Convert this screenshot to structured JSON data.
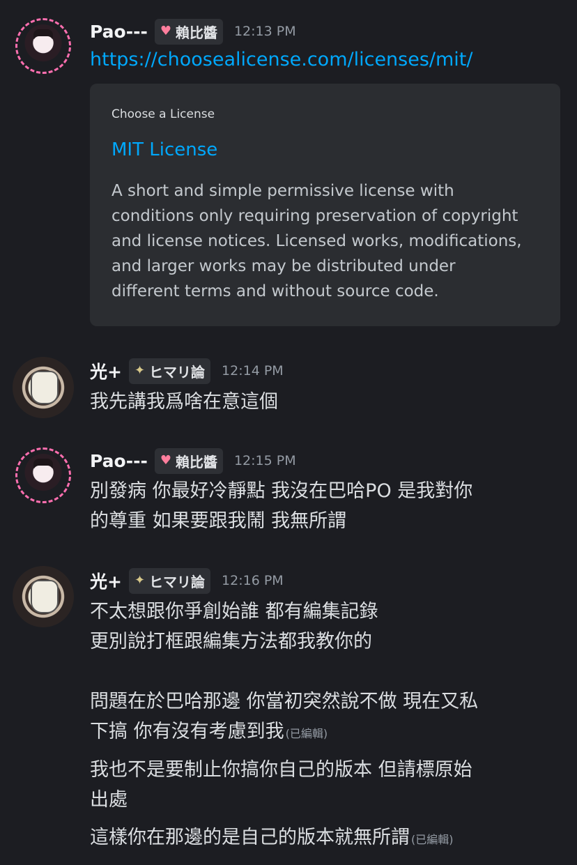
{
  "messages": [
    {
      "username": "Pao---",
      "role": "賴比醬",
      "time": "12:13 PM",
      "link": "https://choosealicense.com/licenses/mit/",
      "embed": {
        "provider": "Choose a License",
        "title": "MIT License",
        "description": "A short and simple permissive license with\nconditions only requiring preservation of copyright\nand license notices. Licensed works, modifications,\nand larger works may be distributed under\ndifferent terms and without source code."
      }
    },
    {
      "username": "光+",
      "role": "ヒマリ論",
      "time": "12:14 PM",
      "lines": [
        "我先講我爲啥在意這個"
      ]
    },
    {
      "username": "Pao---",
      "role": "賴比醬",
      "time": "12:15 PM",
      "lines": [
        "別發病 你最好冷靜點  我沒在巴哈PO 是我對你",
        "的尊重 如果要跟我鬧 我無所謂"
      ]
    },
    {
      "username": "光+",
      "role": "ヒマリ論",
      "time": "12:16 PM",
      "lines": [
        "不太想跟你爭創始誰 都有編集記錄",
        "更別說打框跟編集方法都我教你的",
        "問題在於巴哈那邊 你當初突然說不做 現在又私",
        "下搞 你有沒有考慮到我",
        "我也不是要制止你搞你自己的版本 但請標原始",
        "出處",
        "這樣你在那邊的是自己的版本就無所謂"
      ],
      "edited_label": "(已編輯)"
    }
  ],
  "colors": {
    "background": "#1c1d22",
    "link": "#00a8fc",
    "embed_bg": "#2b2d31",
    "timestamp": "#949ba4"
  }
}
